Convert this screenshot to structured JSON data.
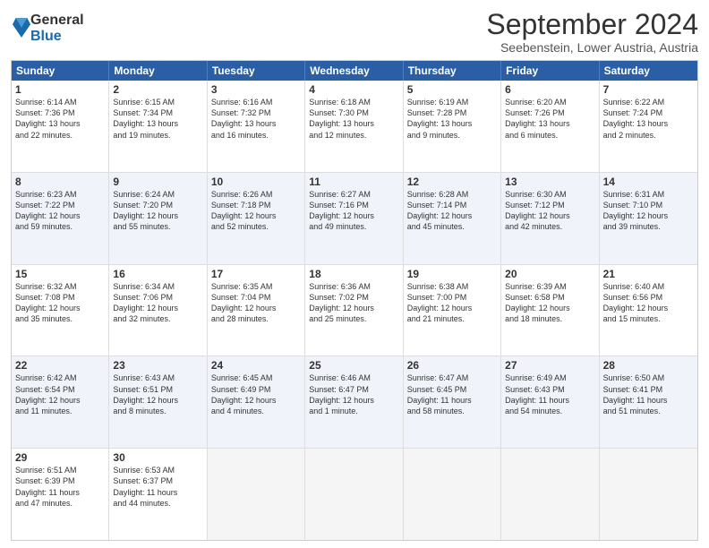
{
  "logo": {
    "general": "General",
    "blue": "Blue"
  },
  "header": {
    "month": "September 2024",
    "location": "Seebenstein, Lower Austria, Austria"
  },
  "days": [
    "Sunday",
    "Monday",
    "Tuesday",
    "Wednesday",
    "Thursday",
    "Friday",
    "Saturday"
  ],
  "rows": [
    [
      {
        "day": "1",
        "lines": [
          "Sunrise: 6:14 AM",
          "Sunset: 7:36 PM",
          "Daylight: 13 hours",
          "and 22 minutes."
        ]
      },
      {
        "day": "2",
        "lines": [
          "Sunrise: 6:15 AM",
          "Sunset: 7:34 PM",
          "Daylight: 13 hours",
          "and 19 minutes."
        ]
      },
      {
        "day": "3",
        "lines": [
          "Sunrise: 6:16 AM",
          "Sunset: 7:32 PM",
          "Daylight: 13 hours",
          "and 16 minutes."
        ]
      },
      {
        "day": "4",
        "lines": [
          "Sunrise: 6:18 AM",
          "Sunset: 7:30 PM",
          "Daylight: 13 hours",
          "and 12 minutes."
        ]
      },
      {
        "day": "5",
        "lines": [
          "Sunrise: 6:19 AM",
          "Sunset: 7:28 PM",
          "Daylight: 13 hours",
          "and 9 minutes."
        ]
      },
      {
        "day": "6",
        "lines": [
          "Sunrise: 6:20 AM",
          "Sunset: 7:26 PM",
          "Daylight: 13 hours",
          "and 6 minutes."
        ]
      },
      {
        "day": "7",
        "lines": [
          "Sunrise: 6:22 AM",
          "Sunset: 7:24 PM",
          "Daylight: 13 hours",
          "and 2 minutes."
        ]
      }
    ],
    [
      {
        "day": "8",
        "lines": [
          "Sunrise: 6:23 AM",
          "Sunset: 7:22 PM",
          "Daylight: 12 hours",
          "and 59 minutes."
        ]
      },
      {
        "day": "9",
        "lines": [
          "Sunrise: 6:24 AM",
          "Sunset: 7:20 PM",
          "Daylight: 12 hours",
          "and 55 minutes."
        ]
      },
      {
        "day": "10",
        "lines": [
          "Sunrise: 6:26 AM",
          "Sunset: 7:18 PM",
          "Daylight: 12 hours",
          "and 52 minutes."
        ]
      },
      {
        "day": "11",
        "lines": [
          "Sunrise: 6:27 AM",
          "Sunset: 7:16 PM",
          "Daylight: 12 hours",
          "and 49 minutes."
        ]
      },
      {
        "day": "12",
        "lines": [
          "Sunrise: 6:28 AM",
          "Sunset: 7:14 PM",
          "Daylight: 12 hours",
          "and 45 minutes."
        ]
      },
      {
        "day": "13",
        "lines": [
          "Sunrise: 6:30 AM",
          "Sunset: 7:12 PM",
          "Daylight: 12 hours",
          "and 42 minutes."
        ]
      },
      {
        "day": "14",
        "lines": [
          "Sunrise: 6:31 AM",
          "Sunset: 7:10 PM",
          "Daylight: 12 hours",
          "and 39 minutes."
        ]
      }
    ],
    [
      {
        "day": "15",
        "lines": [
          "Sunrise: 6:32 AM",
          "Sunset: 7:08 PM",
          "Daylight: 12 hours",
          "and 35 minutes."
        ]
      },
      {
        "day": "16",
        "lines": [
          "Sunrise: 6:34 AM",
          "Sunset: 7:06 PM",
          "Daylight: 12 hours",
          "and 32 minutes."
        ]
      },
      {
        "day": "17",
        "lines": [
          "Sunrise: 6:35 AM",
          "Sunset: 7:04 PM",
          "Daylight: 12 hours",
          "and 28 minutes."
        ]
      },
      {
        "day": "18",
        "lines": [
          "Sunrise: 6:36 AM",
          "Sunset: 7:02 PM",
          "Daylight: 12 hours",
          "and 25 minutes."
        ]
      },
      {
        "day": "19",
        "lines": [
          "Sunrise: 6:38 AM",
          "Sunset: 7:00 PM",
          "Daylight: 12 hours",
          "and 21 minutes."
        ]
      },
      {
        "day": "20",
        "lines": [
          "Sunrise: 6:39 AM",
          "Sunset: 6:58 PM",
          "Daylight: 12 hours",
          "and 18 minutes."
        ]
      },
      {
        "day": "21",
        "lines": [
          "Sunrise: 6:40 AM",
          "Sunset: 6:56 PM",
          "Daylight: 12 hours",
          "and 15 minutes."
        ]
      }
    ],
    [
      {
        "day": "22",
        "lines": [
          "Sunrise: 6:42 AM",
          "Sunset: 6:54 PM",
          "Daylight: 12 hours",
          "and 11 minutes."
        ]
      },
      {
        "day": "23",
        "lines": [
          "Sunrise: 6:43 AM",
          "Sunset: 6:51 PM",
          "Daylight: 12 hours",
          "and 8 minutes."
        ]
      },
      {
        "day": "24",
        "lines": [
          "Sunrise: 6:45 AM",
          "Sunset: 6:49 PM",
          "Daylight: 12 hours",
          "and 4 minutes."
        ]
      },
      {
        "day": "25",
        "lines": [
          "Sunrise: 6:46 AM",
          "Sunset: 6:47 PM",
          "Daylight: 12 hours",
          "and 1 minute."
        ]
      },
      {
        "day": "26",
        "lines": [
          "Sunrise: 6:47 AM",
          "Sunset: 6:45 PM",
          "Daylight: 11 hours",
          "and 58 minutes."
        ]
      },
      {
        "day": "27",
        "lines": [
          "Sunrise: 6:49 AM",
          "Sunset: 6:43 PM",
          "Daylight: 11 hours",
          "and 54 minutes."
        ]
      },
      {
        "day": "28",
        "lines": [
          "Sunrise: 6:50 AM",
          "Sunset: 6:41 PM",
          "Daylight: 11 hours",
          "and 51 minutes."
        ]
      }
    ],
    [
      {
        "day": "29",
        "lines": [
          "Sunrise: 6:51 AM",
          "Sunset: 6:39 PM",
          "Daylight: 11 hours",
          "and 47 minutes."
        ]
      },
      {
        "day": "30",
        "lines": [
          "Sunrise: 6:53 AM",
          "Sunset: 6:37 PM",
          "Daylight: 11 hours",
          "and 44 minutes."
        ]
      },
      {
        "day": "",
        "lines": []
      },
      {
        "day": "",
        "lines": []
      },
      {
        "day": "",
        "lines": []
      },
      {
        "day": "",
        "lines": []
      },
      {
        "day": "",
        "lines": []
      }
    ]
  ]
}
